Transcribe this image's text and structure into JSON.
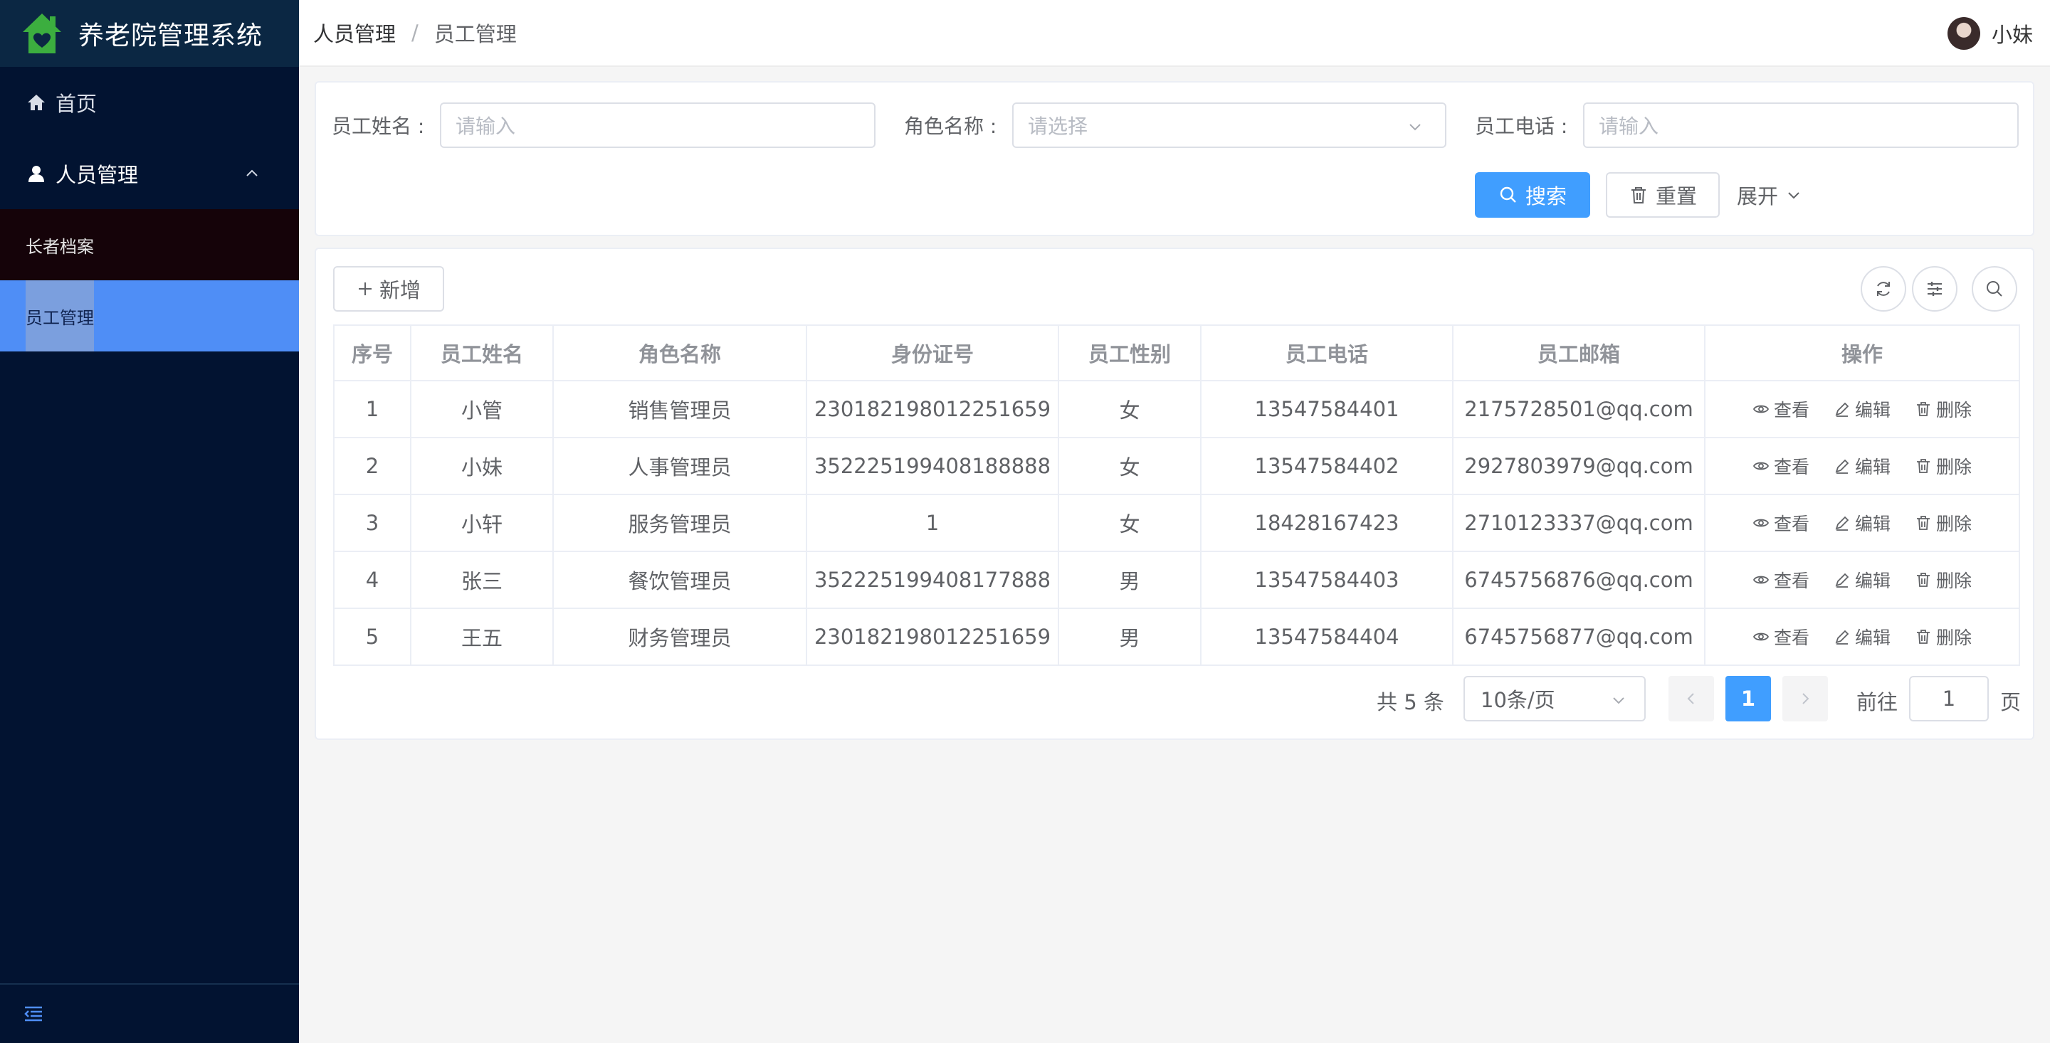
{
  "app": {
    "title": "养老院管理系统"
  },
  "sidebar": {
    "items": [
      {
        "label": "首页",
        "icon": "home-icon"
      },
      {
        "label": "人员管理",
        "icon": "user-icon",
        "expanded": true,
        "children": [
          {
            "label": "长者档案"
          },
          {
            "label": "员工管理",
            "active": true
          }
        ]
      }
    ],
    "collapse_icon": "menu-collapse-icon"
  },
  "header": {
    "breadcrumb": [
      "人员管理",
      "员工管理"
    ],
    "separator": "/",
    "user_name": "小妹"
  },
  "filters": {
    "name_label": "员工姓名 :",
    "name_placeholder": "请输入",
    "role_label": "角色名称 :",
    "role_placeholder": "请选择",
    "phone_label": "员工电话 :",
    "phone_placeholder": "请输入",
    "search_label": "搜索",
    "reset_label": "重置",
    "expand_label": "展开"
  },
  "toolbar": {
    "add_label": "新增"
  },
  "table": {
    "columns": [
      "序号",
      "员工姓名",
      "角色名称",
      "身份证号",
      "员工性别",
      "员工电话",
      "员工邮箱",
      "操作"
    ],
    "rows": [
      {
        "no": "1",
        "name": "小管",
        "role": "销售管理员",
        "id": "230182198012251659",
        "gender": "女",
        "phone": "13547584401",
        "email": "2175728501@qq.com"
      },
      {
        "no": "2",
        "name": "小妹",
        "role": "人事管理员",
        "id": "352225199408188888",
        "gender": "女",
        "phone": "13547584402",
        "email": "2927803979@qq.com"
      },
      {
        "no": "3",
        "name": "小轩",
        "role": "服务管理员",
        "id": "1",
        "gender": "女",
        "phone": "18428167423",
        "email": "2710123337@qq.com"
      },
      {
        "no": "4",
        "name": "张三",
        "role": "餐饮管理员",
        "id": "352225199408177888",
        "gender": "男",
        "phone": "13547584403",
        "email": "6745756876@qq.com"
      },
      {
        "no": "5",
        "name": "王五",
        "role": "财务管理员",
        "id": "230182198012251659",
        "gender": "男",
        "phone": "13547584404",
        "email": "6745756877@qq.com"
      }
    ],
    "actions": {
      "view": "查看",
      "edit": "编辑",
      "delete": "删除"
    }
  },
  "pagination": {
    "total_text": "共 5 条",
    "page_size": "10条/页",
    "current_page": "1",
    "goto_label": "前往",
    "goto_value": "1",
    "page_suffix": "页"
  },
  "colors": {
    "sidebar_bg": "#021331",
    "active_menu": "#4f8ef6",
    "primary": "#409eff",
    "logo_green": "#3cae3f"
  }
}
